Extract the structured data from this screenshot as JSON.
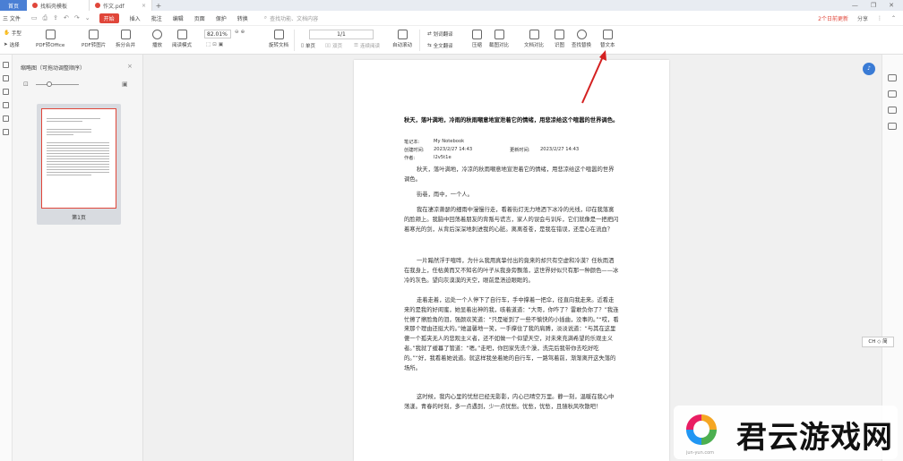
{
  "tabs": {
    "home": "首页",
    "tab1": "找稻壳模板",
    "tab2": "作文.pdf",
    "add": "+"
  },
  "window": {
    "min": "—",
    "max": "❐",
    "close": "✕"
  },
  "menu": {
    "file": "三 文件",
    "items": [
      "开始",
      "插入",
      "批注",
      "编辑",
      "页面",
      "保护",
      "转换"
    ],
    "active_index": 0,
    "search_placeholder": "查找功能、文档内容",
    "right_update": "2个日前更新",
    "right_share": "分享",
    "accent_color": "#e0463a"
  },
  "toolbar": {
    "hand": "手型",
    "select": "选择",
    "pdf_to_office": "PDF转Office",
    "pdf_to_image": "PDF转图片",
    "split_merge": "拆分合并",
    "play": "播放",
    "read_mode": "阅读模式",
    "zoom_value": "82.01%",
    "rotate": "旋转文档",
    "single_page": "单页",
    "double_page": "双页",
    "continuous": "连续阅读",
    "auto_scroll": "自动滚动",
    "page_indicator": "1/1",
    "translate": "划词翻译",
    "full_translate": "全文翻译",
    "compress": "压缩",
    "compare": "截图对比",
    "doc_compare": "文档对比",
    "ocr": "识图",
    "find_replace": "查找替换",
    "replace_text": "替文本"
  },
  "thumbnail_panel": {
    "title": "缩略图（可拖动调整顺序）",
    "page_label": "第1页"
  },
  "document": {
    "title": "秋天，落叶满地，冷雨的秋雨嘲意地宣泄着它的情绪，用悲凉给这个喧嚣的世界调色。",
    "meta": {
      "notebook_label": "笔记本:",
      "notebook_value": "My Notebook",
      "created_label": "创建时间:",
      "created_value": "2023/2/27 14:43",
      "updated_label": "更新时间:",
      "updated_value": "2023/2/27 14:43",
      "author_label": "作者:",
      "author_value": "l2v5t1e"
    },
    "paragraphs": [
      "秋天，落叶满地，冷凉的秋雨嘲意地宣泄着它的情绪，用悲凉给这个喧嚣的世界调色。",
      "街巷，雨中，一个人。",
      "我在凄凉萧瑟的细雨中漫慢行走，看着街灯无力地洒下冰冷的光线，印在我落寞的脸颊上。我脑中回荡着朋友的背叛与谎言，家人的误会与训斥，它们就像是一把把闪着寒光的剑，从背后深深地刺进我的心脏。离离苍苍，是我在错误，还是心在流血？",
      "一片黯然浮于喧哗，为什么我用真挚付出的竟来的却只有空虚和冷漠？任秋雨洒在我身上，任枯黄而又不知名的叶子从我身旁飘落，这世界好似只有那一种颜色——冰冷的灰色。望向灰漠漠的天空，眼前是溃迫眼眶的。",
      "走着走着，远处一个人停下了自行车，手中撑着一把伞，径直向我走来。近看走来的是我的好闺蜜，她显着出神的我，咳着道道：“大哥，你咋了？雷敢负你了？”我连忙擦了擦脸角的泪，强颜欢笑道：“只是碰到了一些不愉快的小插曲，没事的。”“哎，看来那个理由还挺大的。”她温馨地一笑，一手撑住了我的肩膊，淡淡说道：“与其在这里傻一个孤夹无人的悲观主义者，还不如做一个仰望天空，对未来充满希望的乐观主义者。”我就了缓暮了管道：“嗯。”走吧，你回家先洗个澡，洗完后我带你去吃好吃的。”“好，我看着她说道。就这样我坐着她的自行车，一路驾着前，渐渐离开这失落的场所。",
      "这时候，我内心里的忧愁已经无影影，内心已晴空万里。静一刻，温暖在我心中荡漾。青春的时刻，多一点遇到，少一点忧愁。忧愁，忧愁，且随秋风吹散吧！"
    ]
  },
  "right_panel": {
    "ime": "CH ◇ 简"
  },
  "watermark": {
    "text": "君云游戏网",
    "sub": "jun-yun.com"
  }
}
